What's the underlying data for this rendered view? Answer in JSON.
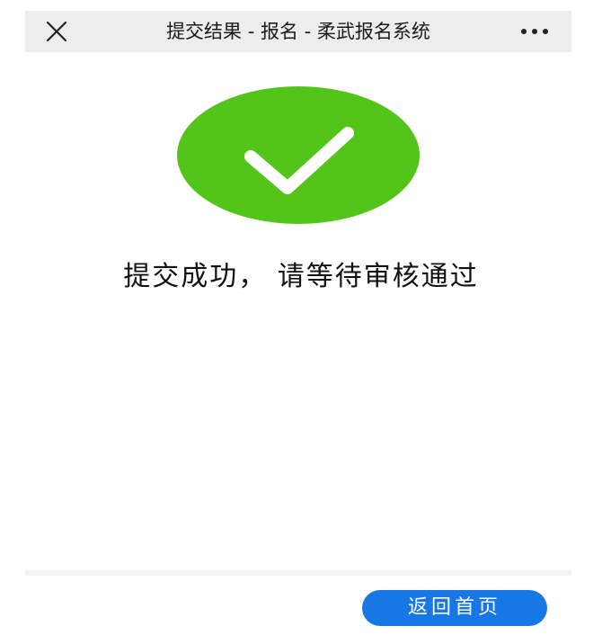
{
  "navbar": {
    "title": "提交结果 - 报名 - 柔武报名系统",
    "close_icon": "close-icon",
    "more_icon": "more-icon"
  },
  "result": {
    "icon": "check-icon",
    "status_color": "#52c41a",
    "message": "提交成功， 请等待审核通过"
  },
  "footer": {
    "home_button_label": "返回首页",
    "button_color": "#1677e5"
  }
}
